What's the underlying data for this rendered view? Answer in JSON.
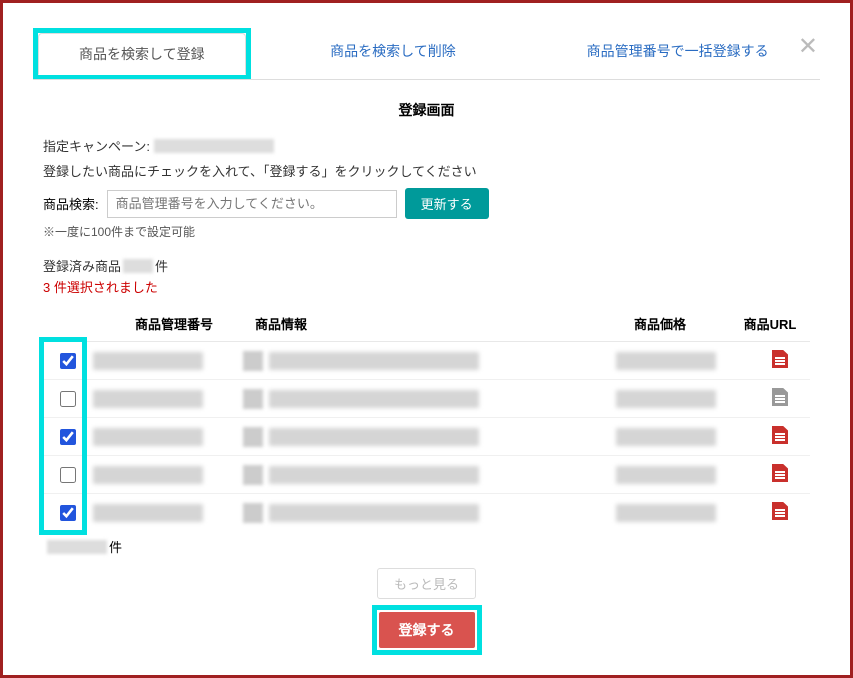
{
  "close": "✕",
  "tabs": {
    "t0": "商品を検索して登録",
    "t1": "商品を検索して削除",
    "t2": "商品管理番号で一括登録する"
  },
  "panel": {
    "title": "登録画面",
    "campaign_label": "指定キャンペーン:",
    "instruction": "登録したい商品にチェックを入れて、「登録する」をクリックしてください",
    "search_label": "商品検索:",
    "search_placeholder": "商品管理番号を入力してください。",
    "update_btn": "更新する",
    "limit_note": "※一度に100件まで設定可能",
    "registered_prefix": "登録済み商品",
    "registered_suffix": "件",
    "selected": "3 件選択されました"
  },
  "headers": {
    "id": "商品管理番号",
    "info": "商品情報",
    "price": "商品価格",
    "url": "商品URL"
  },
  "rows": [
    {
      "checked": true,
      "url_active": true
    },
    {
      "checked": false,
      "url_active": false
    },
    {
      "checked": true,
      "url_active": true
    },
    {
      "checked": false,
      "url_active": true
    },
    {
      "checked": true,
      "url_active": true
    }
  ],
  "page_suffix": "件",
  "footer": {
    "more": "もっと見る",
    "register": "登録する"
  }
}
